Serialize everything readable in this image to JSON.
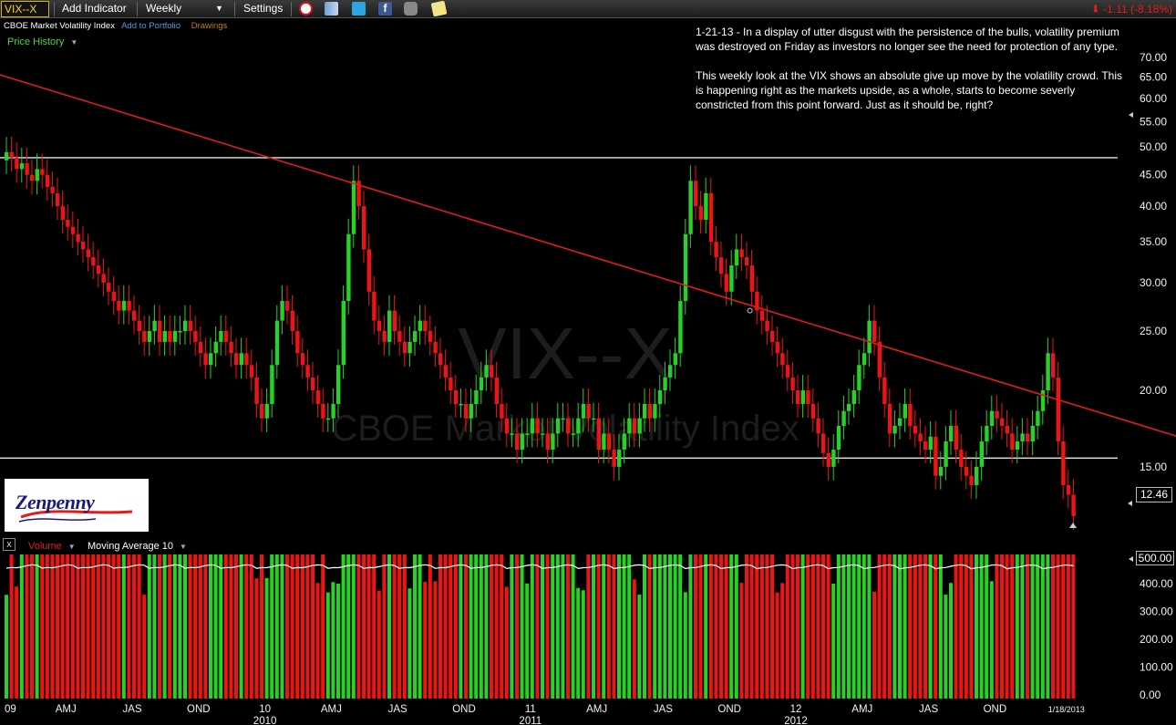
{
  "toolbar": {
    "symbol": "VIX--X",
    "add_indicator": "Add Indicator",
    "period": "Weekly",
    "settings": "Settings",
    "change": "-1.11 (-8.18%)"
  },
  "subrow": {
    "name": "CBOE Market Volatility Index",
    "add_portfolio": "Add to Portfolio",
    "drawings": "Drawings"
  },
  "price_history_label": "Price History",
  "commentary": {
    "p1": "1-21-13 - In a display of utter disgust with the persistence of the bulls, volatility premium was destroyed on Friday as investors no longer see the need for protection of any type.",
    "p2": "This weekly look at the VIX shows an absolute give up move by the volatility crowd. This is happening right as the markets upside, as a whole, starts to become severly constricted from this point forward. Just as it should be, right?"
  },
  "watermark": {
    "symbol": "VIX--X",
    "name": "CBOE Market Volatility Index"
  },
  "logo": {
    "text": "Zenpenny"
  },
  "current_price": "12.46",
  "volume_panel": {
    "name": "Volume",
    "ma": "Moving Average 10",
    "max_label": "500.00"
  },
  "colors": {
    "up": "#27d127",
    "down": "#ef1414",
    "trendline": "#e21c1c",
    "axis_text": "#f2f2f2",
    "accent": "#ffd800"
  },
  "chart_data": {
    "type": "candlestick",
    "title": "CBOE Market Volatility Index",
    "y_scale": "log",
    "ylim": [
      12,
      75
    ],
    "y_ticks": [
      "70.00",
      "65.00",
      "60.00",
      "55.00",
      "50.00",
      "45.00",
      "40.00",
      "35.00",
      "30.00",
      "25.00",
      "20.00",
      "15.00"
    ],
    "x_tick_labels": [
      {
        "label": "09",
        "i": 0
      },
      {
        "label": "AMJ",
        "i": 12
      },
      {
        "label": "JAS",
        "i": 25
      },
      {
        "label": "OND",
        "i": 38
      },
      {
        "label": "10",
        "i": 51
      },
      {
        "label": "AMJ",
        "i": 64
      },
      {
        "label": "JAS",
        "i": 77
      },
      {
        "label": "OND",
        "i": 90
      },
      {
        "label": "11",
        "i": 103
      },
      {
        "label": "AMJ",
        "i": 116
      },
      {
        "label": "JAS",
        "i": 129
      },
      {
        "label": "OND",
        "i": 142
      },
      {
        "label": "12",
        "i": 155
      },
      {
        "label": "AMJ",
        "i": 168
      },
      {
        "label": "JAS",
        "i": 181
      },
      {
        "label": "OND",
        "i": 194
      },
      {
        "label": "1/18/2013",
        "i": 208
      }
    ],
    "year_labels": [
      {
        "label": "2010",
        "i": 51
      },
      {
        "label": "2011",
        "i": 103
      },
      {
        "label": "2012",
        "i": 155
      }
    ],
    "horizontal_lines": [
      48,
      15.5
    ],
    "trendline": [
      {
        "i": -2,
        "v": 66
      },
      {
        "i": 234,
        "v": 16.4
      }
    ],
    "closes": [
      49,
      48,
      46,
      47,
      45,
      44,
      46,
      45,
      43,
      42,
      40,
      38,
      37,
      36,
      35,
      34,
      33,
      32,
      31,
      30,
      29,
      28,
      27,
      28,
      27,
      26,
      25,
      24,
      25,
      26,
      24,
      25,
      24,
      25,
      25,
      26,
      25,
      24,
      23,
      22,
      23,
      24,
      25,
      24,
      23,
      22,
      23,
      22,
      21,
      19,
      18,
      19,
      22,
      26,
      28,
      27,
      25,
      23,
      22,
      21,
      20,
      19,
      18,
      18,
      19,
      22,
      28,
      36,
      44,
      40,
      34,
      29,
      26,
      25,
      24,
      27,
      25,
      24,
      23,
      24,
      25,
      26,
      25,
      24,
      23,
      22,
      21,
      20,
      19,
      19,
      18,
      19,
      20,
      21,
      22,
      21,
      19,
      18,
      17,
      17,
      16,
      17,
      17,
      18,
      17,
      17,
      16,
      17,
      18,
      18,
      17,
      17,
      18,
      19,
      18,
      18,
      16,
      17,
      16,
      15,
      16,
      17,
      18,
      17,
      18,
      19,
      18,
      19,
      20,
      21,
      22,
      23,
      28,
      36,
      44,
      40,
      38,
      42,
      35,
      33,
      31,
      29,
      32,
      34,
      33,
      32,
      29,
      27,
      26,
      25,
      24,
      23,
      22,
      21,
      20,
      19,
      20,
      19,
      18,
      17,
      15.8,
      15,
      16,
      17.5,
      18.5,
      19,
      20,
      22,
      23,
      26,
      24,
      21,
      19,
      17,
      17.5,
      18,
      19,
      17.5,
      17,
      16.5,
      16,
      16.8,
      14.5,
      15,
      16.5,
      17.5,
      16,
      15,
      14.5,
      14,
      15,
      16.5,
      17.5,
      18.5,
      18,
      17.5,
      17,
      16,
      16.5,
      17,
      16.5,
      17.5,
      18.5,
      20,
      23,
      21,
      16.5,
      14,
      13.5,
      12.46
    ]
  }
}
